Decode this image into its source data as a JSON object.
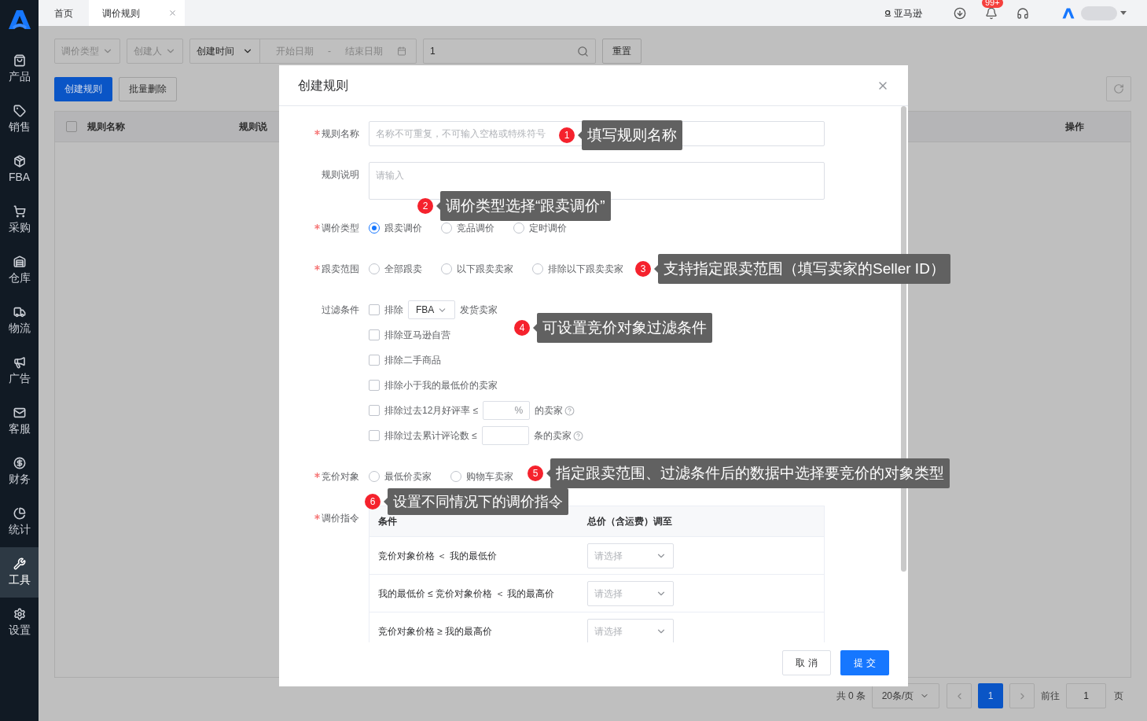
{
  "sidebar": {
    "items": [
      {
        "label": "产品",
        "selected": false
      },
      {
        "label": "销售",
        "selected": false
      },
      {
        "label": "FBA",
        "selected": false
      },
      {
        "label": "采购",
        "selected": false
      },
      {
        "label": "仓库",
        "selected": false
      },
      {
        "label": "物流",
        "selected": false
      },
      {
        "label": "广告",
        "selected": false
      },
      {
        "label": "客服",
        "selected": false
      },
      {
        "label": "财务",
        "selected": false
      },
      {
        "label": "统计",
        "selected": false
      },
      {
        "label": "工具",
        "selected": true
      },
      {
        "label": "设置",
        "selected": false
      }
    ]
  },
  "tabs": [
    {
      "label": "首页",
      "selected": false,
      "closable": false
    },
    {
      "label": "调价规则",
      "selected": true,
      "closable": true
    }
  ],
  "header": {
    "marketplace": "亚马逊",
    "notification_count": "99+"
  },
  "filters": {
    "type": "调价类型",
    "creator": "创建人",
    "time_field": "创建时间",
    "start_placeholder": "开始日期",
    "separator": "-",
    "end_placeholder": "结束日期",
    "search_value": "1",
    "reset": "重置"
  },
  "actions": [
    {
      "label": "创建规则",
      "kind": "primary"
    },
    {
      "label": "批量删除",
      "kind": "default"
    }
  ],
  "table": {
    "select_all_checked": false,
    "columns": [
      "规则名称",
      "规则说",
      "操作"
    ]
  },
  "pagination": {
    "total": "共 0 条",
    "page_size": "20条/页",
    "pages": [
      {
        "label": "1",
        "selected": true
      }
    ],
    "goto_label": "前往",
    "goto_value": "1",
    "page_suffix": "页"
  },
  "dialog": {
    "title": "创建规则",
    "name": {
      "label": "规则名称",
      "required": true,
      "placeholder": "名称不可重复，不可输入空格或特殊符号"
    },
    "description": {
      "label": "规则说明",
      "required": false,
      "placeholder": "请输入"
    },
    "price_type": {
      "label": "调价类型",
      "required": true,
      "options": [
        {
          "label": "跟卖调价",
          "selected": true
        },
        {
          "label": "竞品调价",
          "selected": false
        },
        {
          "label": "定时调价",
          "selected": false
        }
      ]
    },
    "scope": {
      "label": "跟卖范围",
      "required": true,
      "options": [
        {
          "label": "全部跟卖",
          "selected": false
        },
        {
          "label": "以下跟卖卖家",
          "selected": false
        },
        {
          "label": "排除以下跟卖卖家",
          "selected": false
        }
      ]
    },
    "filter_conditions": {
      "label": "过滤条件",
      "required": false,
      "items": [
        {
          "kind": "select",
          "checked": false,
          "prefix": "排除",
          "value": "FBA",
          "suffix": "发货卖家"
        },
        {
          "kind": "plain",
          "checked": false,
          "prefix": "排除亚马逊自营"
        },
        {
          "kind": "plain",
          "checked": false,
          "prefix": "排除二手商品"
        },
        {
          "kind": "plain",
          "checked": false,
          "prefix": "排除小于我的最低价的卖家"
        },
        {
          "kind": "input",
          "checked": false,
          "prefix": "排除过去12月好评率 ≤",
          "unit": "%",
          "suffix": "的卖家"
        },
        {
          "kind": "input",
          "checked": false,
          "prefix": "排除过去累计评论数 ≤",
          "suffix": "条的卖家"
        }
      ]
    },
    "target": {
      "label": "竞价对象",
      "required": true,
      "options": [
        {
          "label": "最低价卖家",
          "selected": false
        },
        {
          "label": "购物车卖家",
          "selected": false
        }
      ]
    },
    "instructions": {
      "label": "调价指令",
      "required": true,
      "columns": [
        "条件",
        "总价（含运费）调至"
      ],
      "rows": [
        {
          "condition": "竞价对象价格 ＜ 我的最低价",
          "placeholder": "请选择"
        },
        {
          "condition": "我的最低价 ≤ 竞价对象价格 ＜ 我的最高价",
          "placeholder": "请选择"
        },
        {
          "condition": "竞价对象价格 ≥ 我的最高价",
          "placeholder": "请选择"
        }
      ]
    },
    "buttons": [
      {
        "label": "取 消",
        "kind": "default"
      },
      {
        "label": "提 交",
        "kind": "primary"
      }
    ]
  },
  "callouts": [
    {
      "number": "1",
      "text": "填写规则名称"
    },
    {
      "number": "2",
      "text": "调价类型选择“跟卖调价”"
    },
    {
      "number": "3",
      "text": "支持指定跟卖范围（填写卖家的Seller ID）"
    },
    {
      "number": "4",
      "text": "可设置竞价对象过滤条件"
    },
    {
      "number": "5",
      "text": "指定跟卖范围、过滤条件后的数据中选择要竞价的对象类型"
    },
    {
      "number": "6",
      "text": "设置不同情况下的调价指令"
    }
  ]
}
